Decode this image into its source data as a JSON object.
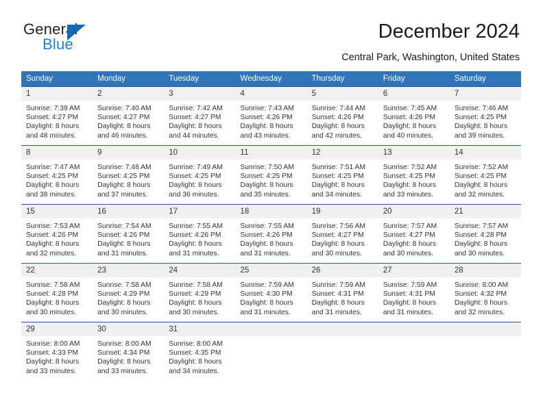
{
  "logo": {
    "word1": "General",
    "word2": "Blue",
    "triangle_color": "#1a69b0",
    "word2_color": "#1a7fd4"
  },
  "header": {
    "title": "December 2024",
    "subtitle": "Central Park, Washington, United States"
  },
  "colors": {
    "header_row": "#3075b8",
    "row_divider": "#1f5ba8",
    "daynum_band": "#f0f0f0",
    "text": "#333333"
  },
  "calendar": {
    "weekday_headers": [
      "Sunday",
      "Monday",
      "Tuesday",
      "Wednesday",
      "Thursday",
      "Friday",
      "Saturday"
    ],
    "weeks": [
      [
        {
          "day": "1",
          "sunrise": "Sunrise: 7:39 AM",
          "sunset": "Sunset: 4:27 PM",
          "daylight1": "Daylight: 8 hours",
          "daylight2": "and 48 minutes."
        },
        {
          "day": "2",
          "sunrise": "Sunrise: 7:40 AM",
          "sunset": "Sunset: 4:27 PM",
          "daylight1": "Daylight: 8 hours",
          "daylight2": "and 46 minutes."
        },
        {
          "day": "3",
          "sunrise": "Sunrise: 7:42 AM",
          "sunset": "Sunset: 4:27 PM",
          "daylight1": "Daylight: 8 hours",
          "daylight2": "and 44 minutes."
        },
        {
          "day": "4",
          "sunrise": "Sunrise: 7:43 AM",
          "sunset": "Sunset: 4:26 PM",
          "daylight1": "Daylight: 8 hours",
          "daylight2": "and 43 minutes."
        },
        {
          "day": "5",
          "sunrise": "Sunrise: 7:44 AM",
          "sunset": "Sunset: 4:26 PM",
          "daylight1": "Daylight: 8 hours",
          "daylight2": "and 42 minutes."
        },
        {
          "day": "6",
          "sunrise": "Sunrise: 7:45 AM",
          "sunset": "Sunset: 4:26 PM",
          "daylight1": "Daylight: 8 hours",
          "daylight2": "and 40 minutes."
        },
        {
          "day": "7",
          "sunrise": "Sunrise: 7:46 AM",
          "sunset": "Sunset: 4:25 PM",
          "daylight1": "Daylight: 8 hours",
          "daylight2": "and 39 minutes."
        }
      ],
      [
        {
          "day": "8",
          "sunrise": "Sunrise: 7:47 AM",
          "sunset": "Sunset: 4:25 PM",
          "daylight1": "Daylight: 8 hours",
          "daylight2": "and 38 minutes."
        },
        {
          "day": "9",
          "sunrise": "Sunrise: 7:48 AM",
          "sunset": "Sunset: 4:25 PM",
          "daylight1": "Daylight: 8 hours",
          "daylight2": "and 37 minutes."
        },
        {
          "day": "10",
          "sunrise": "Sunrise: 7:49 AM",
          "sunset": "Sunset: 4:25 PM",
          "daylight1": "Daylight: 8 hours",
          "daylight2": "and 36 minutes."
        },
        {
          "day": "11",
          "sunrise": "Sunrise: 7:50 AM",
          "sunset": "Sunset: 4:25 PM",
          "daylight1": "Daylight: 8 hours",
          "daylight2": "and 35 minutes."
        },
        {
          "day": "12",
          "sunrise": "Sunrise: 7:51 AM",
          "sunset": "Sunset: 4:25 PM",
          "daylight1": "Daylight: 8 hours",
          "daylight2": "and 34 minutes."
        },
        {
          "day": "13",
          "sunrise": "Sunrise: 7:52 AM",
          "sunset": "Sunset: 4:25 PM",
          "daylight1": "Daylight: 8 hours",
          "daylight2": "and 33 minutes."
        },
        {
          "day": "14",
          "sunrise": "Sunrise: 7:52 AM",
          "sunset": "Sunset: 4:25 PM",
          "daylight1": "Daylight: 8 hours",
          "daylight2": "and 32 minutes."
        }
      ],
      [
        {
          "day": "15",
          "sunrise": "Sunrise: 7:53 AM",
          "sunset": "Sunset: 4:26 PM",
          "daylight1": "Daylight: 8 hours",
          "daylight2": "and 32 minutes."
        },
        {
          "day": "16",
          "sunrise": "Sunrise: 7:54 AM",
          "sunset": "Sunset: 4:26 PM",
          "daylight1": "Daylight: 8 hours",
          "daylight2": "and 31 minutes."
        },
        {
          "day": "17",
          "sunrise": "Sunrise: 7:55 AM",
          "sunset": "Sunset: 4:26 PM",
          "daylight1": "Daylight: 8 hours",
          "daylight2": "and 31 minutes."
        },
        {
          "day": "18",
          "sunrise": "Sunrise: 7:55 AM",
          "sunset": "Sunset: 4:26 PM",
          "daylight1": "Daylight: 8 hours",
          "daylight2": "and 31 minutes."
        },
        {
          "day": "19",
          "sunrise": "Sunrise: 7:56 AM",
          "sunset": "Sunset: 4:27 PM",
          "daylight1": "Daylight: 8 hours",
          "daylight2": "and 30 minutes."
        },
        {
          "day": "20",
          "sunrise": "Sunrise: 7:57 AM",
          "sunset": "Sunset: 4:27 PM",
          "daylight1": "Daylight: 8 hours",
          "daylight2": "and 30 minutes."
        },
        {
          "day": "21",
          "sunrise": "Sunrise: 7:57 AM",
          "sunset": "Sunset: 4:28 PM",
          "daylight1": "Daylight: 8 hours",
          "daylight2": "and 30 minutes."
        }
      ],
      [
        {
          "day": "22",
          "sunrise": "Sunrise: 7:58 AM",
          "sunset": "Sunset: 4:28 PM",
          "daylight1": "Daylight: 8 hours",
          "daylight2": "and 30 minutes."
        },
        {
          "day": "23",
          "sunrise": "Sunrise: 7:58 AM",
          "sunset": "Sunset: 4:29 PM",
          "daylight1": "Daylight: 8 hours",
          "daylight2": "and 30 minutes."
        },
        {
          "day": "24",
          "sunrise": "Sunrise: 7:58 AM",
          "sunset": "Sunset: 4:29 PM",
          "daylight1": "Daylight: 8 hours",
          "daylight2": "and 30 minutes."
        },
        {
          "day": "25",
          "sunrise": "Sunrise: 7:59 AM",
          "sunset": "Sunset: 4:30 PM",
          "daylight1": "Daylight: 8 hours",
          "daylight2": "and 31 minutes."
        },
        {
          "day": "26",
          "sunrise": "Sunrise: 7:59 AM",
          "sunset": "Sunset: 4:31 PM",
          "daylight1": "Daylight: 8 hours",
          "daylight2": "and 31 minutes."
        },
        {
          "day": "27",
          "sunrise": "Sunrise: 7:59 AM",
          "sunset": "Sunset: 4:31 PM",
          "daylight1": "Daylight: 8 hours",
          "daylight2": "and 31 minutes."
        },
        {
          "day": "28",
          "sunrise": "Sunrise: 8:00 AM",
          "sunset": "Sunset: 4:32 PM",
          "daylight1": "Daylight: 8 hours",
          "daylight2": "and 32 minutes."
        }
      ],
      [
        {
          "day": "29",
          "sunrise": "Sunrise: 8:00 AM",
          "sunset": "Sunset: 4:33 PM",
          "daylight1": "Daylight: 8 hours",
          "daylight2": "and 33 minutes."
        },
        {
          "day": "30",
          "sunrise": "Sunrise: 8:00 AM",
          "sunset": "Sunset: 4:34 PM",
          "daylight1": "Daylight: 8 hours",
          "daylight2": "and 33 minutes."
        },
        {
          "day": "31",
          "sunrise": "Sunrise: 8:00 AM",
          "sunset": "Sunset: 4:35 PM",
          "daylight1": "Daylight: 8 hours",
          "daylight2": "and 34 minutes."
        },
        {
          "day": "",
          "sunrise": "",
          "sunset": "",
          "daylight1": "",
          "daylight2": ""
        },
        {
          "day": "",
          "sunrise": "",
          "sunset": "",
          "daylight1": "",
          "daylight2": ""
        },
        {
          "day": "",
          "sunrise": "",
          "sunset": "",
          "daylight1": "",
          "daylight2": ""
        },
        {
          "day": "",
          "sunrise": "",
          "sunset": "",
          "daylight1": "",
          "daylight2": ""
        }
      ]
    ]
  }
}
